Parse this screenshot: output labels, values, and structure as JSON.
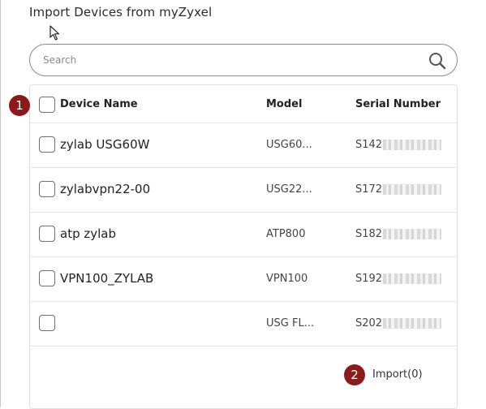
{
  "title": "Import Devices from myZyxel",
  "search": {
    "placeholder": "Search",
    "value": "",
    "icon": "search-icon"
  },
  "table": {
    "headers": {
      "name": "Device Name",
      "model": "Model",
      "serial": "Serial Number"
    },
    "rows": [
      {
        "name": "zylab USG60W",
        "model": "USG60...",
        "serial": "S142"
      },
      {
        "name": "zylabvpn22-00",
        "model": "USG22...",
        "serial": "S172"
      },
      {
        "name": "atp zylab",
        "model": "ATP800",
        "serial": "S182"
      },
      {
        "name": "VPN100_ZYLAB",
        "model": "VPN100",
        "serial": "S192"
      },
      {
        "name": "",
        "model": "USG FL...",
        "serial": "S202"
      }
    ]
  },
  "badges": {
    "first": "1",
    "second": "2"
  },
  "import_label": "Import(0)",
  "colors": {
    "badge": "#8b1a1a",
    "border": "#e0e0e0"
  }
}
